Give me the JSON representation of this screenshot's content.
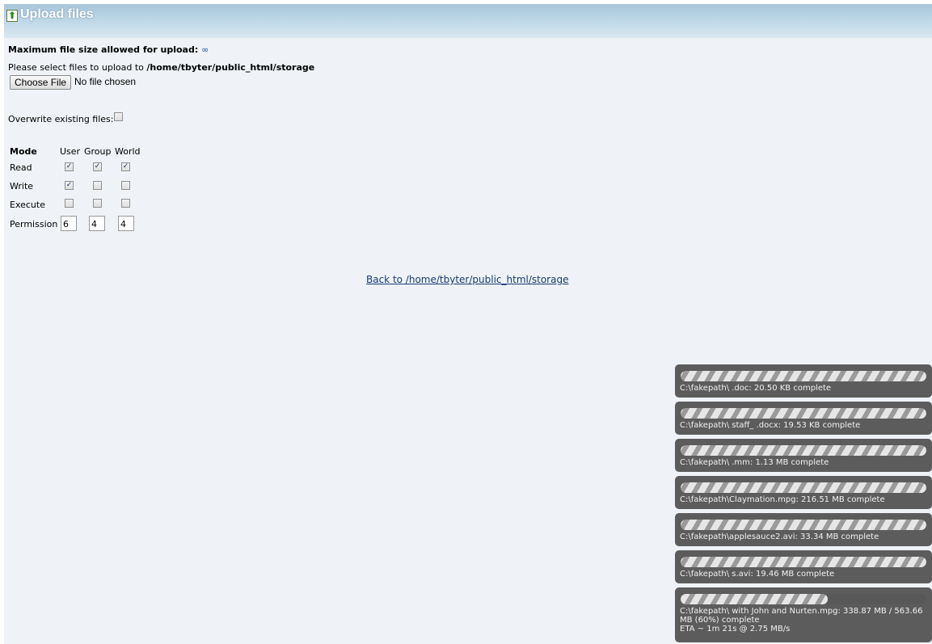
{
  "title": "Upload files",
  "max_size": {
    "label": "Maximum file size allowed for upload:",
    "value": "∞"
  },
  "select": {
    "prefix": "Please select files to upload to",
    "path": "/home/tbyter/public_html/storage"
  },
  "file_input": {
    "button_label": "Choose File",
    "status": "No file chosen"
  },
  "overwrite": {
    "label": "Overwrite existing files:",
    "checked": false
  },
  "mode_table": {
    "headers": [
      "Mode",
      "User",
      "Group",
      "World"
    ],
    "rows": [
      {
        "label": "Read",
        "values": [
          true,
          true,
          true
        ]
      },
      {
        "label": "Write",
        "values": [
          true,
          false,
          false
        ]
      },
      {
        "label": "Execute",
        "values": [
          false,
          false,
          false
        ]
      }
    ],
    "permission": {
      "label": "Permission",
      "values": [
        "6",
        "4",
        "4"
      ]
    }
  },
  "back_link": "Back to /home/tbyter/public_html/storage",
  "uploads": [
    {
      "text": "C:\\fakepath\\                    .doc: 20.50 KB complete",
      "progress": 1.0
    },
    {
      "text": "C:\\fakepath\\         staff_           .docx: 19.53 KB complete",
      "progress": 1.0
    },
    {
      "text": "C:\\fakepath\\                          .mm: 1.13 MB complete",
      "progress": 1.0
    },
    {
      "text": "C:\\fakepath\\Claymation.mpg: 216.51 MB complete",
      "progress": 1.0
    },
    {
      "text": "C:\\fakepath\\applesauce2.avi: 33.34 MB complete",
      "progress": 1.0
    },
    {
      "text": "C:\\fakepath\\                          s.avi: 19.46 MB complete",
      "progress": 1.0
    },
    {
      "text": "C:\\fakepath\\          with John and Nurten.mpg: 338.87 MB / 563.66 MB (60%) complete",
      "eta": "ETA ~ 1m 21s @ 2.75 MB/s",
      "progress": 0.6
    }
  ],
  "colors": {
    "title_gradient_top": "#a8c6da",
    "page_bg": "#eff3f7",
    "upload_panel": "#5c5c5c",
    "link": "#1a3a75"
  }
}
